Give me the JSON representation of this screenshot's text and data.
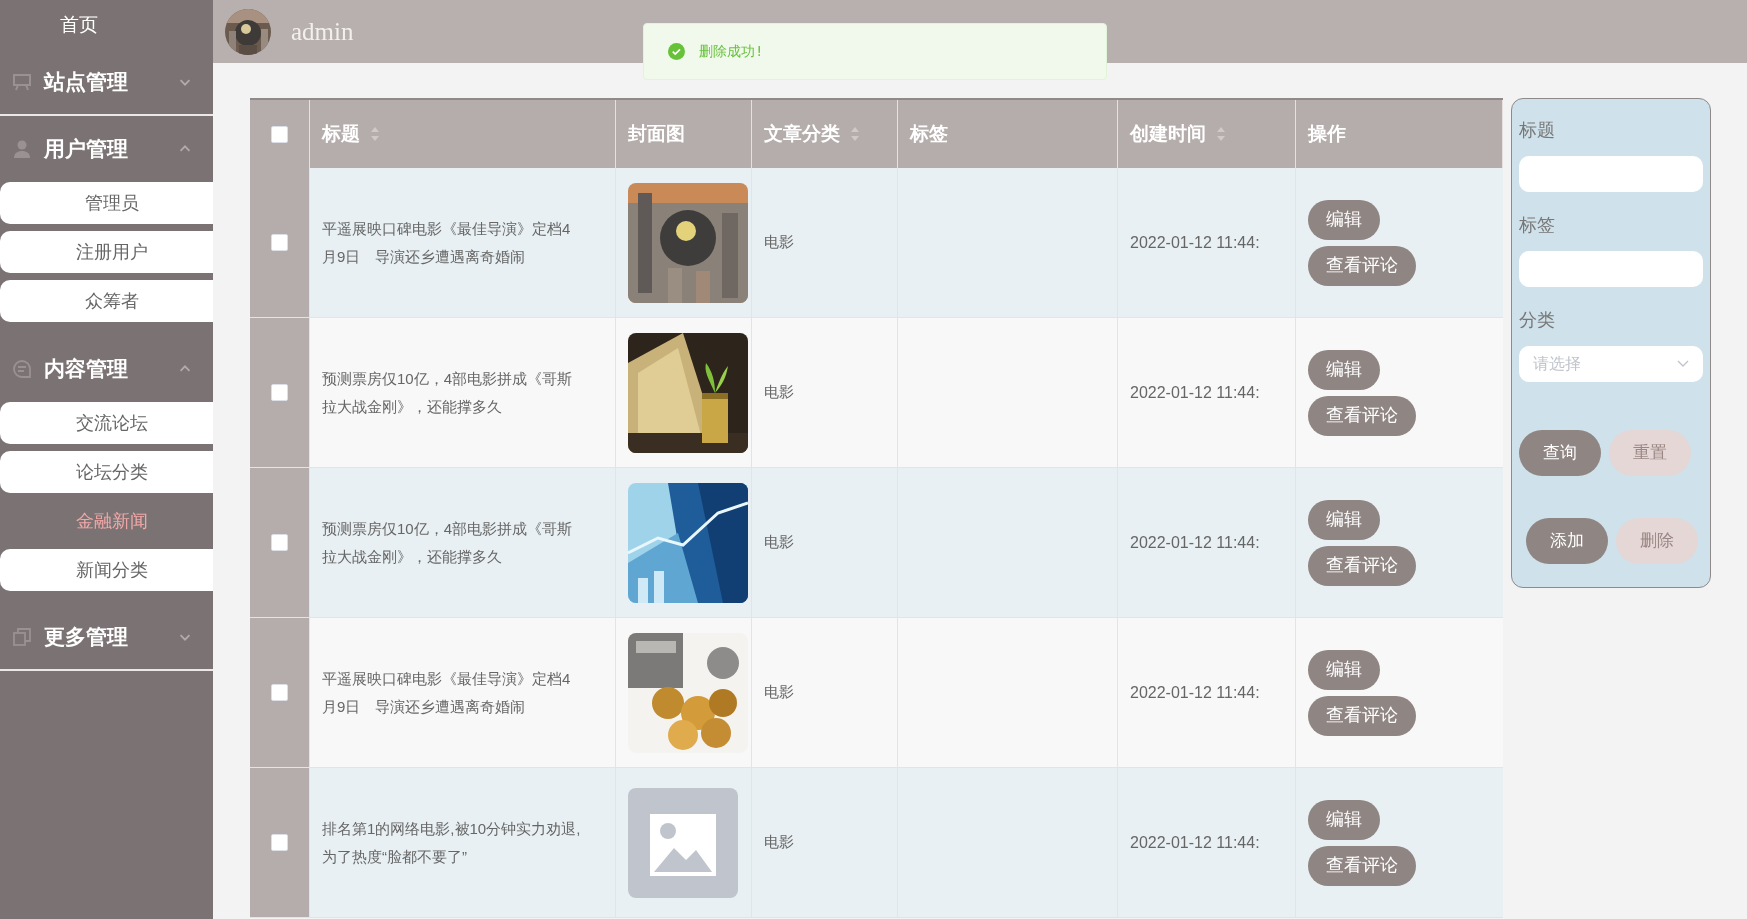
{
  "sidebar": {
    "home": "首页",
    "groups": [
      {
        "label": "站点管理",
        "expanded": false
      },
      {
        "label": "用户管理",
        "expanded": true,
        "children": [
          {
            "label": "管理员",
            "selected": false
          },
          {
            "label": "注册用户",
            "selected": false
          },
          {
            "label": "众筹者",
            "selected": false
          }
        ]
      },
      {
        "label": "内容管理",
        "expanded": true,
        "children": [
          {
            "label": "交流论坛",
            "selected": false
          },
          {
            "label": "论坛分类",
            "selected": false
          },
          {
            "label": "金融新闻",
            "selected": true
          },
          {
            "label": "新闻分类",
            "selected": false
          }
        ]
      },
      {
        "label": "更多管理",
        "expanded": false
      }
    ]
  },
  "header": {
    "username": "admin"
  },
  "toast": {
    "message": "删除成功!"
  },
  "table": {
    "select_all": {
      "checked": false
    },
    "columns": [
      {
        "label": "标题",
        "sortable": true
      },
      {
        "label": "封面图",
        "sortable": false
      },
      {
        "label": "文章分类",
        "sortable": true
      },
      {
        "label": "标签",
        "sortable": false
      },
      {
        "label": "创建时间",
        "sortable": true
      },
      {
        "label": "操作",
        "sortable": false
      }
    ],
    "rows": [
      {
        "checked": false,
        "title": "平遥展映口碑电影《最佳导演》定档4月9日　导演还乡遭遇离奇婚闹",
        "cover": {
          "kind": "picture"
        },
        "category": "电影",
        "created": "2022-01-12 11:44:",
        "actions": [
          "编辑",
          "查看评论"
        ]
      },
      {
        "checked": false,
        "title": "预测票房仅10亿，4部电影拼成《哥斯拉大战金刚》，还能撑多久",
        "cover": {
          "kind": "picture"
        },
        "category": "电影",
        "created": "2022-01-12 11:44:",
        "actions": [
          "编辑",
          "查看评论"
        ]
      },
      {
        "checked": false,
        "title": "预测票房仅10亿，4部电影拼成《哥斯拉大战金刚》，还能撑多久",
        "cover": {
          "kind": "picture"
        },
        "category": "电影",
        "created": "2022-01-12 11:44:",
        "actions": [
          "编辑",
          "查看评论"
        ]
      },
      {
        "checked": false,
        "title": "平遥展映口碑电影《最佳导演》定档4月9日　导演还乡遭遇离奇婚闹",
        "cover": {
          "kind": "picture"
        },
        "category": "电影",
        "created": "2022-01-12 11:44:",
        "actions": [
          "编辑",
          "查看评论"
        ]
      },
      {
        "checked": false,
        "title": "排名第1的网络电影,被10分钟实力劝退,为了热度“脸都不要了”",
        "cover": {
          "kind": "placeholder"
        },
        "category": "电影",
        "created": "2022-01-12 11:44:",
        "actions": [
          "编辑",
          "查看评论"
        ]
      }
    ]
  },
  "search_panel": {
    "fields": [
      {
        "label": "标题",
        "kind": "text"
      },
      {
        "label": "标签",
        "kind": "text"
      },
      {
        "label": "分类",
        "kind": "select",
        "placeholder": "请选择"
      }
    ],
    "button_rows": [
      [
        {
          "label": "查询",
          "kind": "primary"
        },
        {
          "label": "重置",
          "kind": "secondary"
        }
      ],
      [
        {
          "label": "添加",
          "kind": "primary"
        },
        {
          "label": "删除",
          "kind": "secondary"
        }
      ]
    ]
  }
}
